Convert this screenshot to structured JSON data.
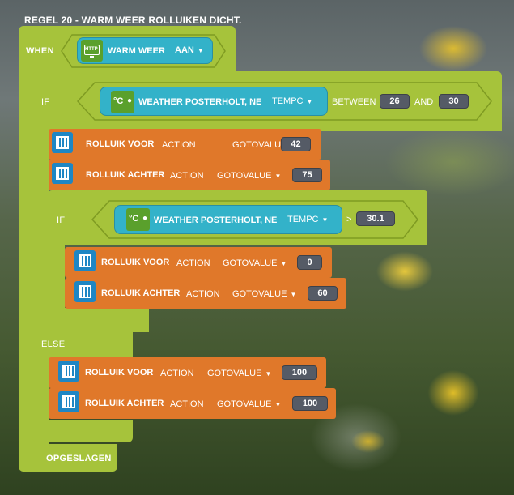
{
  "rule_title": "REGEL 20 - WARM WEER ROLLUIKEN DICHT.",
  "labels": {
    "when": "WHEN",
    "if": "IF",
    "if2": "IF",
    "else": "ELSE",
    "saved": "OPGESLAGEN"
  },
  "trigger": {
    "icon": "http-icon",
    "icon_text": "HTTP",
    "name": "WARM WEER",
    "value": "AAN"
  },
  "condition1": {
    "icon_text": "°C",
    "device": "WEATHER POSTERHOLT, NE",
    "property": "TEMPC",
    "operator": "BETWEEN",
    "low": "26",
    "and": "AND",
    "high": "30"
  },
  "condition2": {
    "icon_text": "°C",
    "device": "WEATHER POSTERHOLT, NE",
    "property": "TEMPC",
    "operator": ">",
    "value": "30.1"
  },
  "actions_then": [
    {
      "device": "ROLLUIK VOOR",
      "action": "ACTION",
      "command": "GOTOVALUE",
      "value": "42"
    },
    {
      "device": "ROLLUIK ACHTER",
      "action": "ACTION",
      "command": "GOTOVALUE",
      "value": "75"
    }
  ],
  "actions_nested": [
    {
      "device": "ROLLUIK VOOR",
      "action": "ACTION",
      "command": "GOTOVALUE",
      "value": "0"
    },
    {
      "device": "ROLLUIK ACHTER",
      "action": "ACTION",
      "command": "GOTOVALUE",
      "value": "60"
    }
  ],
  "actions_else": [
    {
      "device": "ROLLUIK VOOR",
      "action": "ACTION",
      "command": "GOTOVALUE",
      "value": "100"
    },
    {
      "device": "ROLLUIK ACHTER",
      "action": "ACTION",
      "command": "GOTOVALUE",
      "value": "100"
    }
  ],
  "colors": {
    "block_green": "#a6c33b",
    "sensor_cyan": "#33b2c9",
    "action_orange": "#e0782a",
    "device_blue": "#1e86c4",
    "value_gray": "#555b66"
  }
}
